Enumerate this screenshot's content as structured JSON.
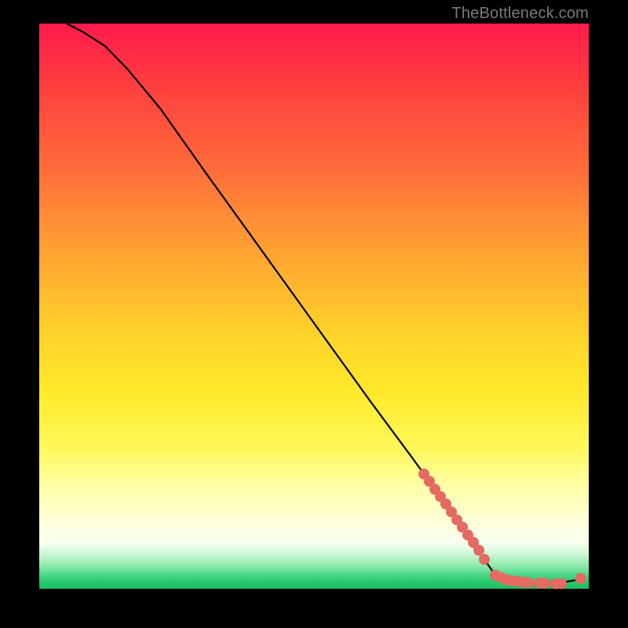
{
  "attribution": "TheBottleneck.com",
  "colors": {
    "dot": "#e46a62",
    "curve": "#000000"
  },
  "chart_data": {
    "type": "line",
    "title": "",
    "xlabel": "",
    "ylabel": "",
    "xlim": [
      0,
      100
    ],
    "ylim": [
      0,
      100
    ],
    "note": "No numeric axis ticks are visible; x/y are fractional positions in the plot (0–100). The black curve descends from top-left, knees near x≈82 and runs flat along the bottom. Salmon dots cluster on the lower segment and along the flat tail.",
    "series": [
      {
        "name": "curve",
        "kind": "line",
        "x": [
          5,
          8,
          12,
          16,
          22,
          30,
          40,
          50,
          60,
          68,
          74,
          78,
          81,
          83,
          86,
          90,
          94,
          98
        ],
        "y": [
          100,
          98.5,
          96,
          92,
          85,
          74,
          60.5,
          47,
          33.5,
          23,
          15,
          9.5,
          5.2,
          2.4,
          1.4,
          1.0,
          0.9,
          1.6
        ]
      },
      {
        "name": "dots",
        "kind": "scatter",
        "x": [
          70,
          71,
          72,
          73,
          74,
          75,
          76,
          77,
          78,
          79,
          80,
          81,
          83,
          84,
          85,
          86,
          87,
          88,
          89,
          91,
          92,
          94,
          95,
          98.5
        ],
        "y": [
          20.3,
          19.0,
          17.6,
          16.3,
          15.0,
          13.6,
          12.2,
          10.9,
          9.5,
          8.2,
          6.8,
          5.2,
          2.4,
          2.0,
          1.6,
          1.4,
          1.3,
          1.2,
          1.1,
          1.0,
          1.0,
          0.9,
          0.9,
          1.8
        ]
      }
    ]
  }
}
